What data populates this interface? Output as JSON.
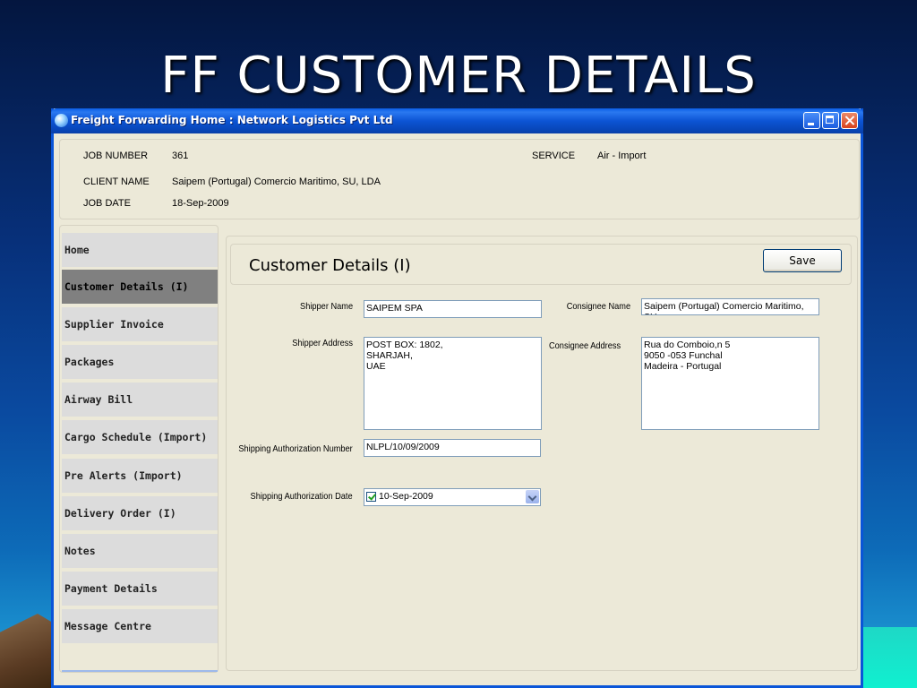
{
  "slide": {
    "title": "FF CUSTOMER DETAILS"
  },
  "window": {
    "title": "Freight Forwarding Home  :  Network Logistics Pvt Ltd"
  },
  "job": {
    "job_number_label": "JOB NUMBER",
    "job_number": "361",
    "client_name_label": "CLIENT NAME",
    "client_name": "Saipem (Portugal) Comercio Maritimo, SU, LDA",
    "job_date_label": "JOB DATE",
    "job_date": "18-Sep-2009",
    "service_label": "SERVICE",
    "service": "Air - Import"
  },
  "nav": {
    "items": [
      {
        "label": "Home"
      },
      {
        "label": "Customer Details (I)"
      },
      {
        "label": "Supplier Invoice"
      },
      {
        "label": "Packages"
      },
      {
        "label": "Airway Bill"
      },
      {
        "label": "Cargo Schedule (Import)"
      },
      {
        "label": "Pre Alerts (Import)"
      },
      {
        "label": "Delivery Order (I)"
      },
      {
        "label": "Notes"
      },
      {
        "label": "Payment Details"
      },
      {
        "label": "Message Centre"
      }
    ],
    "active": "Customer Details (I)"
  },
  "main": {
    "page_title": "Customer Details (I)",
    "save_label": "Save",
    "shipper_name_label": "Shipper Name",
    "shipper_name": "SAIPEM SPA",
    "shipper_address_label": "Shipper Address",
    "shipper_address": "POST BOX: 1802,\nSHARJAH,\nUAE",
    "consignee_name_label": "Consignee Name",
    "consignee_name": "Saipem (Portugal) Comercio Maritimo, SU,",
    "consignee_address_label": "Consignee Address",
    "consignee_address": "Rua do Comboio,n 5\n9050 -053 Funchal\nMadeira - Portugal",
    "auth_number_label": "Shipping Authorization Number",
    "auth_number": "NLPL/10/09/2009",
    "auth_date_label": "Shipping Authorization Date",
    "auth_date": "10-Sep-2009",
    "auth_date_checked": true
  }
}
